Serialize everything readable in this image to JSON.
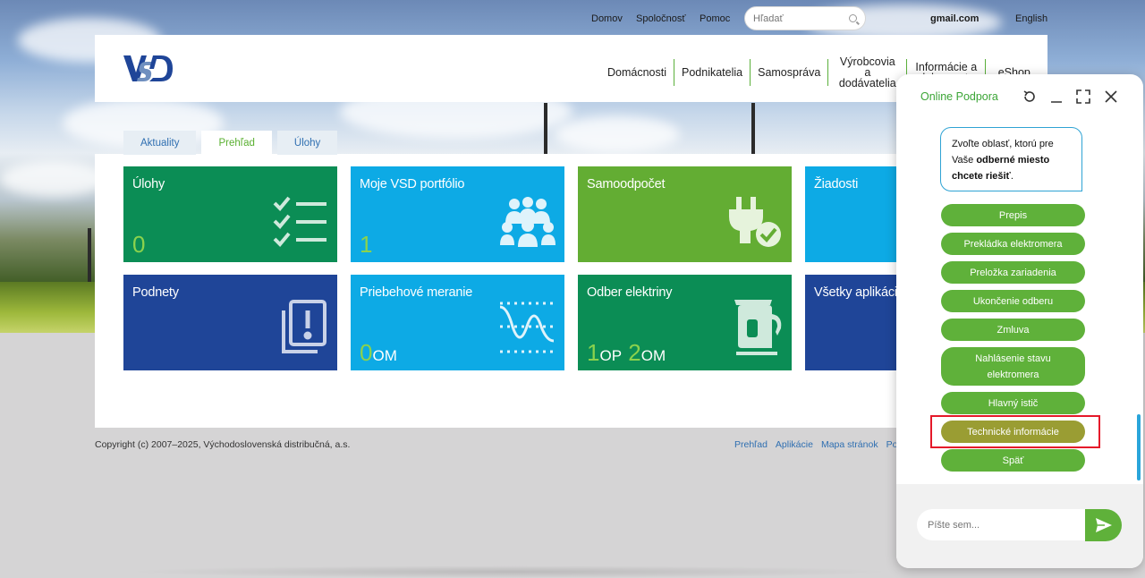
{
  "topbar": {
    "home": "Domov",
    "company": "Spoločnosť",
    "help": "Pomoc",
    "search_placeholder": "Hľadať",
    "account": "gmail.com",
    "language": "English"
  },
  "header": {
    "logo_text": "VSD",
    "nav": [
      {
        "label": "Domácnosti"
      },
      {
        "label": "Podnikatelia"
      },
      {
        "label": "Samospráva"
      },
      {
        "label": "Výrobcovia a dodávatelia"
      },
      {
        "label": "Informácie a dokumenty"
      },
      {
        "label": "eShop"
      }
    ]
  },
  "tabs": [
    {
      "label": "Aktuality",
      "active": false
    },
    {
      "label": "Prehľad",
      "active": true
    },
    {
      "label": "Úlohy",
      "active": false
    }
  ],
  "tiles": [
    {
      "title": "Úlohy",
      "count": "0",
      "icon": "checklist-icon",
      "color": "#0b8d55"
    },
    {
      "title": "Moje VSD portfólio",
      "count": "1",
      "icon": "people-group-icon",
      "color": "#0daae5"
    },
    {
      "title": "Samoodpočet",
      "icon": "plug-check-icon",
      "color": "#63ad33"
    },
    {
      "title": "Žiadosti",
      "color": "#0daae5"
    },
    {
      "title": "Podnety",
      "icon": "exclamation-docs-icon",
      "color": "#1f4598"
    },
    {
      "title": "Priebehové meranie",
      "count": "0",
      "count_unit": "OM",
      "icon": "wave-chart-icon",
      "color": "#0daae5"
    },
    {
      "title": "Odber elektriny",
      "count": "1",
      "count_unit": "OP",
      "count2": "2",
      "count2_unit": "OM",
      "icon": "kettle-icon",
      "color": "#0b8d55"
    },
    {
      "title": "Všetky aplikácie",
      "color": "#1f4598"
    }
  ],
  "footer": {
    "copyright": "Copyright (c) 2007–2025, Východoslovenská distribučná, a.s.",
    "links": [
      "Prehľad",
      "Aplikácie",
      "Mapa stránok",
      "Po"
    ]
  },
  "chat": {
    "title": "Online Podpora",
    "message_pre": "Zvoľte oblasť, ktorú pre Vaše ",
    "message_bold": "odberné miesto chcete riešiť",
    "message_post": ".",
    "options": [
      {
        "label": "Prepis"
      },
      {
        "label": "Prekládka elektromera"
      },
      {
        "label": "Preložka zariadenia"
      },
      {
        "label": "Ukončenie odberu"
      },
      {
        "label": "Zmluva"
      },
      {
        "label": "Nahlásenie stavu elektromera"
      },
      {
        "label": "Hlavný istič"
      },
      {
        "label": "Technické informácie",
        "highlighted": true
      },
      {
        "label": "Späť"
      }
    ],
    "input_placeholder": "Píšte sem..."
  },
  "colors": {
    "brand_green": "#5fb13a",
    "brand_blue": "#2f6fb1",
    "highlight_red": "#e5192a"
  }
}
